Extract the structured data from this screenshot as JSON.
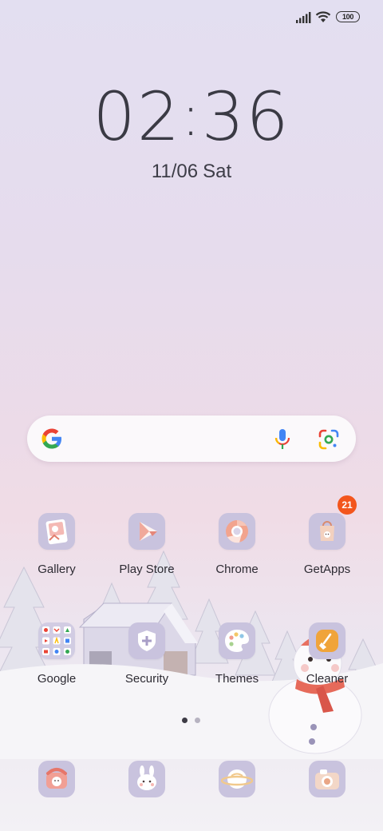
{
  "status_bar": {
    "battery_level": "100",
    "icons": [
      "signal-icon",
      "wifi-icon",
      "battery-icon"
    ]
  },
  "clock": {
    "hours": "02",
    "separator": ":",
    "minutes": "36",
    "date": "11/06",
    "weekday": "Sat"
  },
  "search_bar": {
    "icons": [
      "google-logo-icon",
      "mic-icon",
      "lens-icon"
    ]
  },
  "apps_row1": [
    {
      "label": "Gallery",
      "icon": "gallery-icon"
    },
    {
      "label": "Play Store",
      "icon": "play-store-icon"
    },
    {
      "label": "Chrome",
      "icon": "chrome-icon"
    },
    {
      "label": "GetApps",
      "icon": "getapps-icon",
      "badge": "21"
    }
  ],
  "apps_row2": [
    {
      "label": "Google",
      "icon": "google-folder-icon"
    },
    {
      "label": "Security",
      "icon": "security-icon"
    },
    {
      "label": "Themes",
      "icon": "themes-icon"
    },
    {
      "label": "Cleaner",
      "icon": "cleaner-icon"
    }
  ],
  "page_indicator": {
    "pages": 2,
    "current": 1
  },
  "dock": [
    {
      "icon": "phone-icon"
    },
    {
      "icon": "messages-icon"
    },
    {
      "icon": "browser-icon"
    },
    {
      "icon": "camera-icon"
    }
  ],
  "colors": {
    "icon_background": "#c9c3de",
    "badge": "#f3561d",
    "text": "#2d2b33"
  }
}
